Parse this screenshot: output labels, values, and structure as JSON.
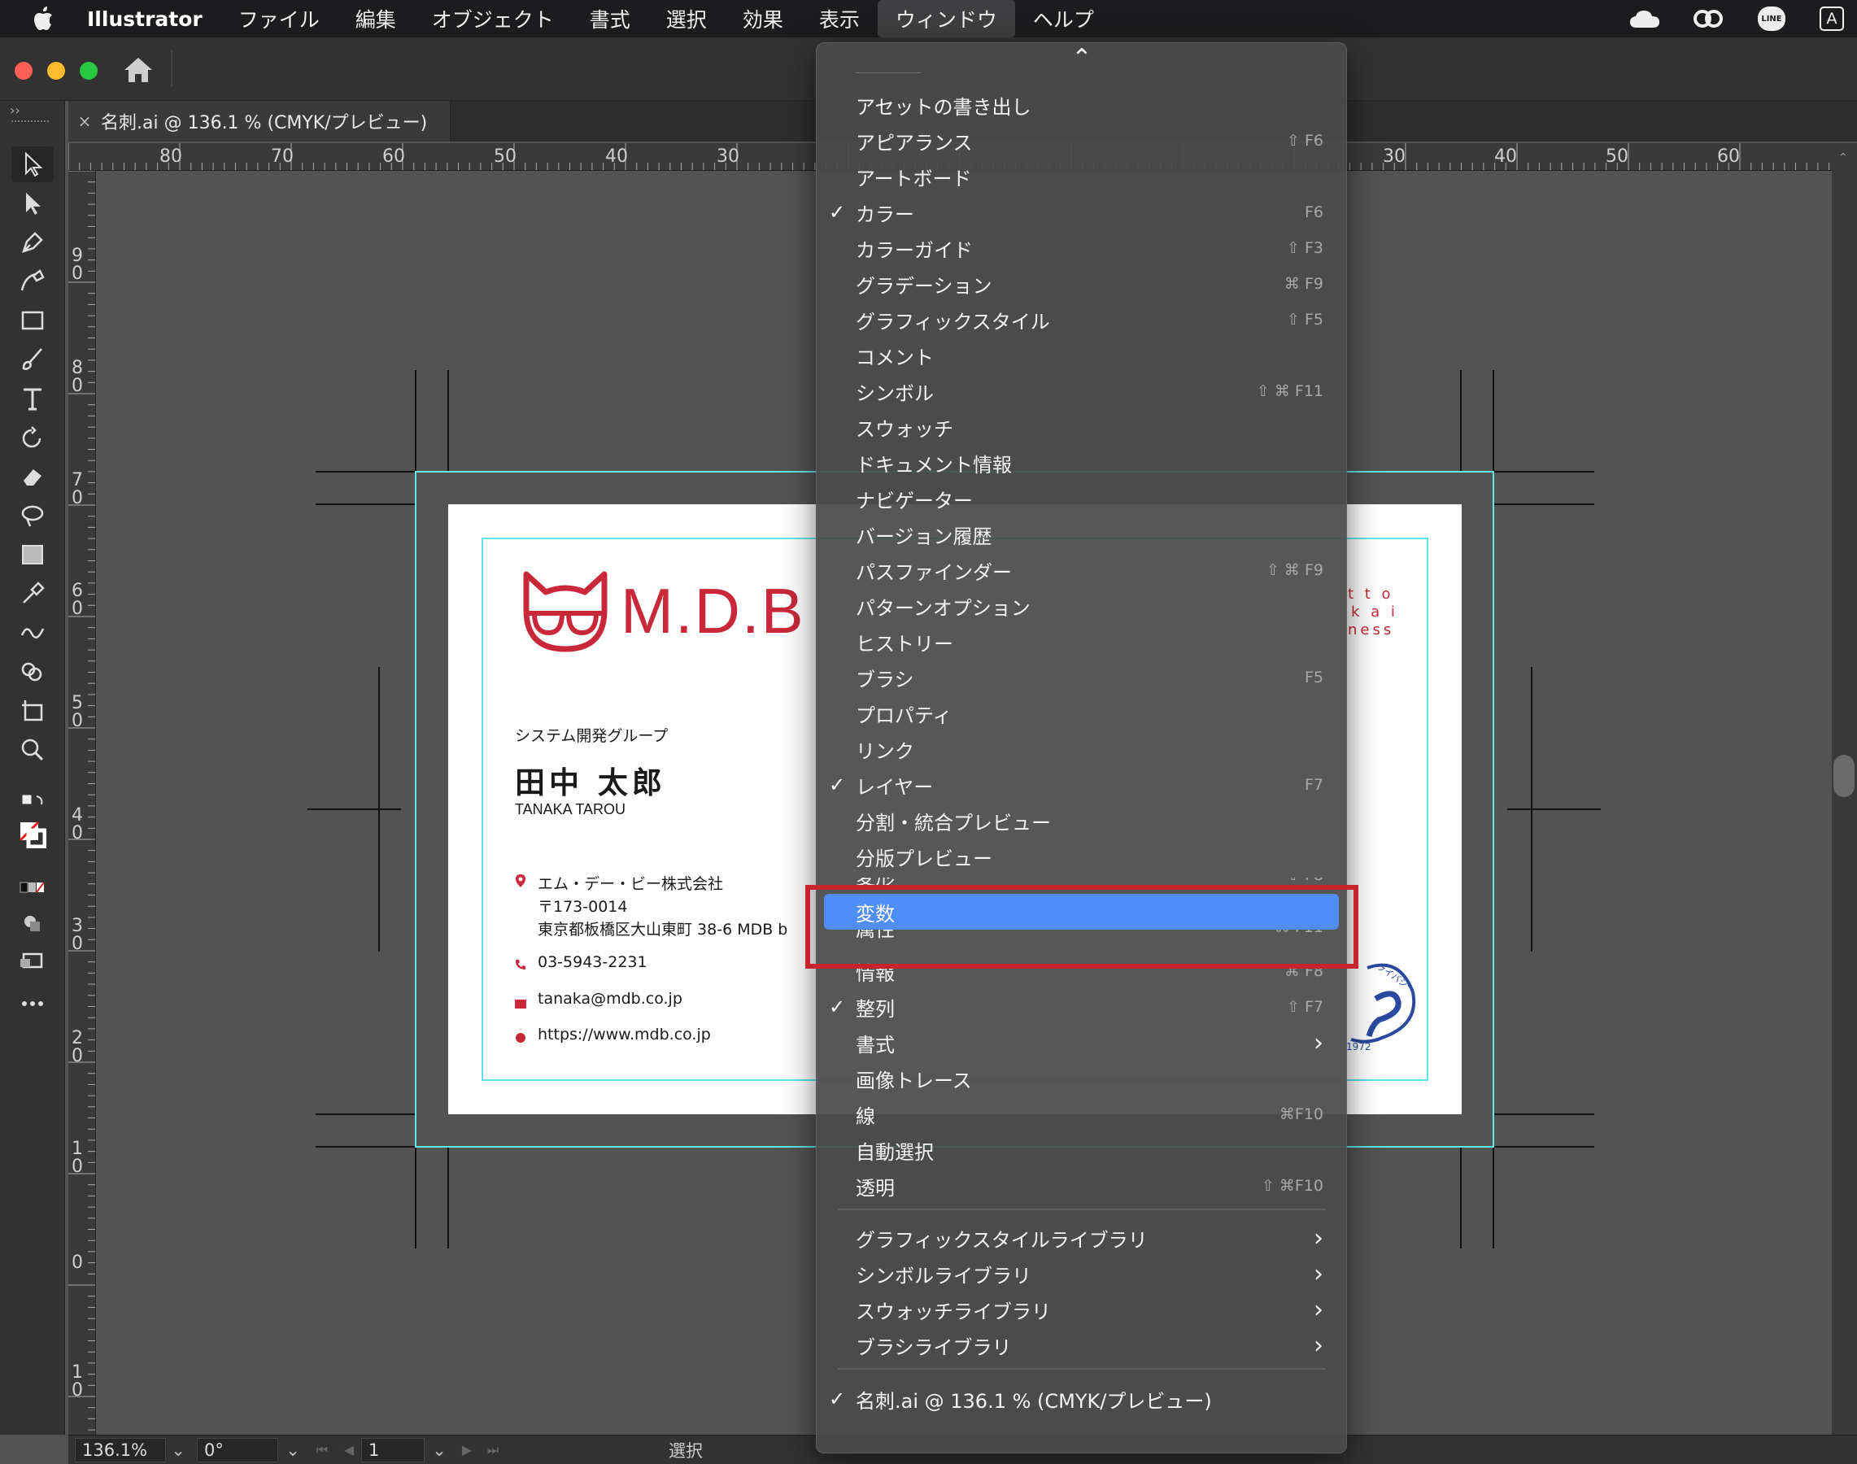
{
  "menubar": {
    "app_name": "Illustrator",
    "items": [
      "ファイル",
      "編集",
      "オブジェクト",
      "書式",
      "選択",
      "効果",
      "表示",
      "ウィンドウ",
      "ヘルプ"
    ],
    "active_index": 7,
    "tray": [
      "cloud-icon",
      "creative-cloud-icon",
      "line-icon",
      "input-a-icon"
    ],
    "input_label": "A",
    "line_label": "LINE"
  },
  "document": {
    "tab_close": "×",
    "tab_title": "名刺.ai @ 136.1 % (CMYK/プレビュー)"
  },
  "ruler": {
    "h_left": [
      "80",
      "70",
      "60",
      "50",
      "40",
      "30"
    ],
    "h_right": [
      "30",
      "40",
      "50",
      "60"
    ],
    "v": [
      "9",
      "0",
      "8",
      "0",
      "7",
      "0",
      "6",
      "0",
      "5",
      "0",
      "4",
      "0",
      "3",
      "0",
      "2",
      "0",
      "1",
      "0",
      "0",
      "1",
      "0"
    ]
  },
  "card": {
    "logo_text": "M.D.B",
    "tagline_lines": [
      "t t o",
      "k a i",
      "ness"
    ],
    "department": "システム開発グループ",
    "name": "田中 太郎",
    "name_romaji": "TANAKA TAROU",
    "company": "エム・デー・ビー株式会社",
    "postal": "〒173-0014",
    "address": "東京都板橋区大山東町 38-6 MDB b",
    "phone": "03-5943-2231",
    "email": "tanaka@mdb.co.jp",
    "url": "https://www.mdb.co.jp",
    "seal_text": "1972",
    "seal_arc": "ライバシー"
  },
  "menu": {
    "scroll_up": "⌃",
    "items": [
      {
        "label": "アセットの書き出し",
        "shortcut": "",
        "checked": false,
        "submenu": false
      },
      {
        "label": "アピアランス",
        "shortcut": "⇧ F6",
        "checked": false,
        "submenu": false
      },
      {
        "label": "アートボード",
        "shortcut": "",
        "checked": false,
        "submenu": false
      },
      {
        "label": "カラー",
        "shortcut": "F6",
        "checked": true,
        "submenu": false
      },
      {
        "label": "カラーガイド",
        "shortcut": "⇧ F3",
        "checked": false,
        "submenu": false
      },
      {
        "label": "グラデーション",
        "shortcut": "⌘ F9",
        "checked": false,
        "submenu": false
      },
      {
        "label": "グラフィックスタイル",
        "shortcut": "⇧ F5",
        "checked": false,
        "submenu": false
      },
      {
        "label": "コメント",
        "shortcut": "",
        "checked": false,
        "submenu": false
      },
      {
        "label": "シンボル",
        "shortcut": "⇧ ⌘ F11",
        "checked": false,
        "submenu": false
      },
      {
        "label": "スウォッチ",
        "shortcut": "",
        "checked": false,
        "submenu": false
      },
      {
        "label": "ドキュメント情報",
        "shortcut": "",
        "checked": false,
        "submenu": false
      },
      {
        "label": "ナビゲーター",
        "shortcut": "",
        "checked": false,
        "submenu": false
      },
      {
        "label": "バージョン履歴",
        "shortcut": "",
        "checked": false,
        "submenu": false
      },
      {
        "label": "パスファインダー",
        "shortcut": "⇧ ⌘ F9",
        "checked": false,
        "submenu": false
      },
      {
        "label": "パターンオプション",
        "shortcut": "",
        "checked": false,
        "submenu": false
      },
      {
        "label": "ヒストリー",
        "shortcut": "",
        "checked": false,
        "submenu": false
      },
      {
        "label": "ブラシ",
        "shortcut": "F5",
        "checked": false,
        "submenu": false
      },
      {
        "label": "プロパティ",
        "shortcut": "",
        "checked": false,
        "submenu": false
      },
      {
        "label": "リンク",
        "shortcut": "",
        "checked": false,
        "submenu": false
      },
      {
        "label": "レイヤー",
        "shortcut": "F7",
        "checked": true,
        "submenu": false
      },
      {
        "label": "分割・統合プレビュー",
        "shortcut": "",
        "checked": false,
        "submenu": false
      },
      {
        "label": "分版プレビュー",
        "shortcut": "",
        "checked": false,
        "submenu": false
      },
      {
        "label": "変形",
        "shortcut": "⇧ F8",
        "checked": false,
        "submenu": false
      },
      {
        "label": "変数",
        "shortcut": "",
        "checked": false,
        "submenu": false
      },
      {
        "label": "属性",
        "shortcut": "⌘ F11",
        "checked": false,
        "submenu": false
      },
      {
        "label": "情報",
        "shortcut": "⌘ F8",
        "checked": false,
        "submenu": false
      },
      {
        "label": "整列",
        "shortcut": "⇧ F7",
        "checked": true,
        "submenu": false
      },
      {
        "label": "書式",
        "shortcut": "",
        "checked": false,
        "submenu": true
      },
      {
        "label": "画像トレース",
        "shortcut": "",
        "checked": false,
        "submenu": false
      },
      {
        "label": "線",
        "shortcut": "⌘F10",
        "checked": false,
        "submenu": false
      },
      {
        "label": "自動選択",
        "shortcut": "",
        "checked": false,
        "submenu": false
      },
      {
        "label": "透明",
        "shortcut": "⇧ ⌘F10",
        "checked": false,
        "submenu": false
      },
      {
        "label": "グラフィックスタイルライブラリ",
        "shortcut": "",
        "checked": false,
        "submenu": true
      },
      {
        "label": "シンボルライブラリ",
        "shortcut": "",
        "checked": false,
        "submenu": true
      },
      {
        "label": "スウォッチライブラリ",
        "shortcut": "",
        "checked": false,
        "submenu": true
      },
      {
        "label": "ブラシライブラリ",
        "shortcut": "",
        "checked": false,
        "submenu": true
      },
      {
        "label": "名刺.ai @ 136.1 % (CMYK/プレビュー)",
        "shortcut": "",
        "checked": true,
        "submenu": false
      }
    ],
    "highlighted": "変数",
    "check_glyph": "✓",
    "submenu_glyph": "›"
  },
  "status": {
    "zoom": "136.1%",
    "rotation": "0°",
    "artboard": "1",
    "tool_label": "選択",
    "dropdown_glyph": "⌄",
    "nav_glyphs": [
      "⏮",
      "◀",
      "▶",
      "⏭"
    ]
  },
  "colors": {
    "accent": "#4f8ef7",
    "annotation": "#c8242e",
    "brand_red": "#c9283a",
    "guide_cyan": "#5fe6ea"
  }
}
